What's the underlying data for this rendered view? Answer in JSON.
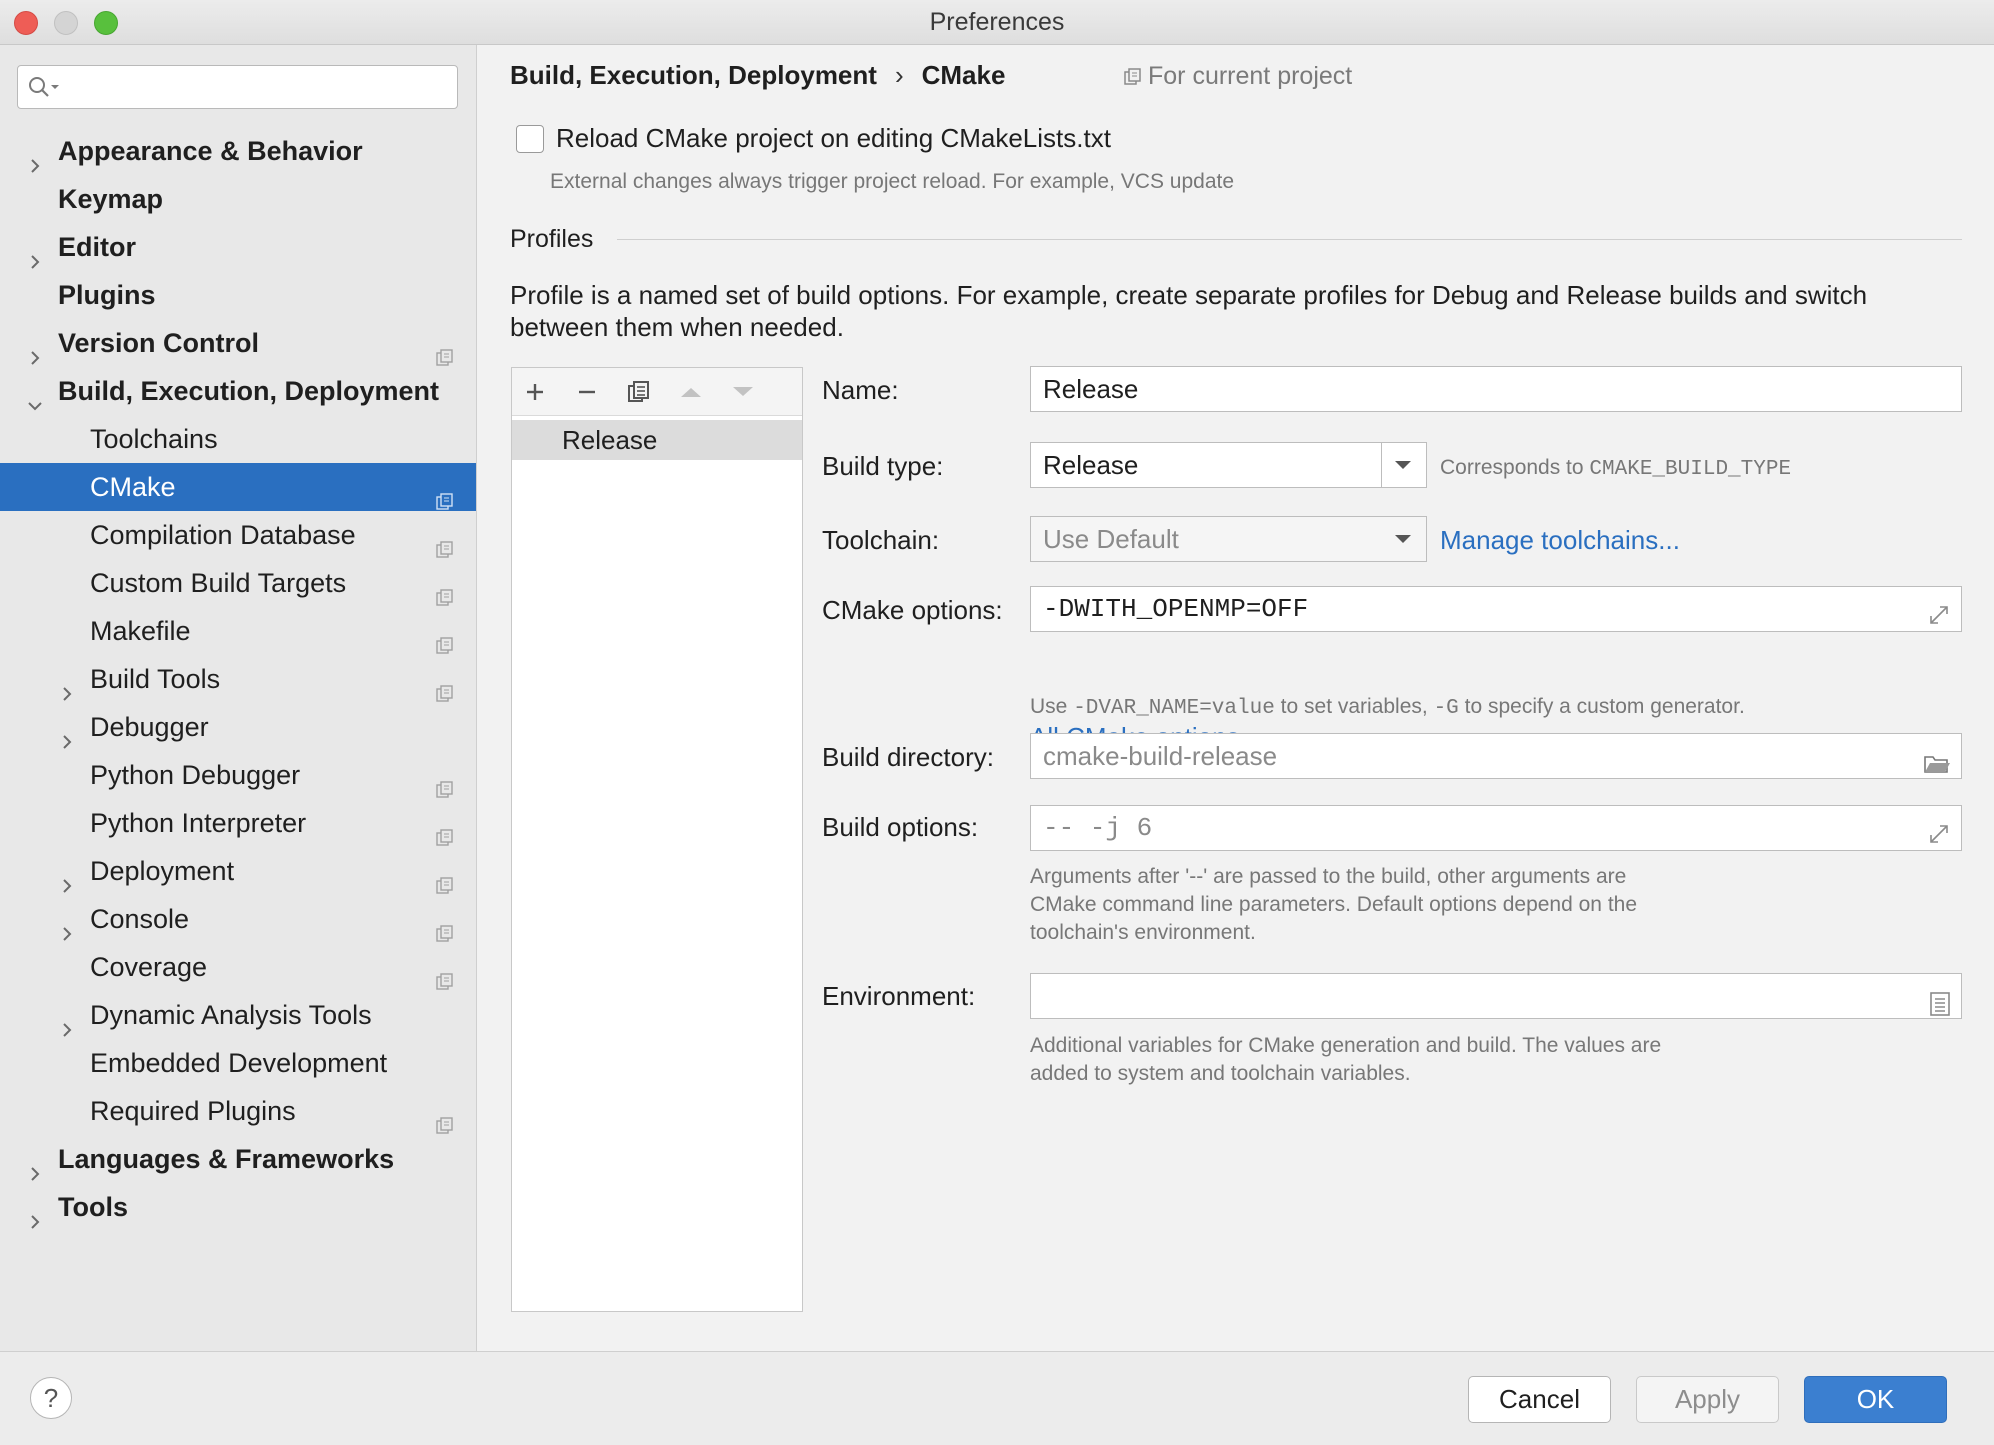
{
  "window": {
    "title": "Preferences"
  },
  "sidebar": {
    "search": {
      "value": "",
      "placeholder": ""
    },
    "items": [
      {
        "label": "Appearance & Behavior",
        "level": 0,
        "bold": true,
        "expander": "collapsed",
        "project_icon": false,
        "selected": false
      },
      {
        "label": "Keymap",
        "level": 0,
        "bold": true,
        "expander": "none",
        "project_icon": false,
        "selected": false
      },
      {
        "label": "Editor",
        "level": 0,
        "bold": true,
        "expander": "collapsed",
        "project_icon": false,
        "selected": false
      },
      {
        "label": "Plugins",
        "level": 0,
        "bold": true,
        "expander": "none",
        "project_icon": false,
        "selected": false
      },
      {
        "label": "Version Control",
        "level": 0,
        "bold": true,
        "expander": "collapsed",
        "project_icon": true,
        "selected": false
      },
      {
        "label": "Build, Execution, Deployment",
        "level": 0,
        "bold": true,
        "expander": "expanded",
        "project_icon": false,
        "selected": false
      },
      {
        "label": "Toolchains",
        "level": 1,
        "bold": false,
        "expander": "none",
        "project_icon": false,
        "selected": false
      },
      {
        "label": "CMake",
        "level": 1,
        "bold": false,
        "expander": "none",
        "project_icon": true,
        "selected": true
      },
      {
        "label": "Compilation Database",
        "level": 1,
        "bold": false,
        "expander": "none",
        "project_icon": true,
        "selected": false
      },
      {
        "label": "Custom Build Targets",
        "level": 1,
        "bold": false,
        "expander": "none",
        "project_icon": true,
        "selected": false
      },
      {
        "label": "Makefile",
        "level": 1,
        "bold": false,
        "expander": "none",
        "project_icon": true,
        "selected": false
      },
      {
        "label": "Build Tools",
        "level": 1,
        "bold": false,
        "expander": "collapsed",
        "project_icon": true,
        "selected": false
      },
      {
        "label": "Debugger",
        "level": 1,
        "bold": false,
        "expander": "collapsed",
        "project_icon": false,
        "selected": false
      },
      {
        "label": "Python Debugger",
        "level": 1,
        "bold": false,
        "expander": "none",
        "project_icon": true,
        "selected": false
      },
      {
        "label": "Python Interpreter",
        "level": 1,
        "bold": false,
        "expander": "none",
        "project_icon": true,
        "selected": false
      },
      {
        "label": "Deployment",
        "level": 1,
        "bold": false,
        "expander": "collapsed",
        "project_icon": true,
        "selected": false
      },
      {
        "label": "Console",
        "level": 1,
        "bold": false,
        "expander": "collapsed",
        "project_icon": true,
        "selected": false
      },
      {
        "label": "Coverage",
        "level": 1,
        "bold": false,
        "expander": "none",
        "project_icon": true,
        "selected": false
      },
      {
        "label": "Dynamic Analysis Tools",
        "level": 1,
        "bold": false,
        "expander": "collapsed",
        "project_icon": false,
        "selected": false
      },
      {
        "label": "Embedded Development",
        "level": 1,
        "bold": false,
        "expander": "none",
        "project_icon": false,
        "selected": false
      },
      {
        "label": "Required Plugins",
        "level": 1,
        "bold": false,
        "expander": "none",
        "project_icon": true,
        "selected": false
      },
      {
        "label": "Languages & Frameworks",
        "level": 0,
        "bold": true,
        "expander": "collapsed",
        "project_icon": false,
        "selected": false
      },
      {
        "label": "Tools",
        "level": 0,
        "bold": true,
        "expander": "collapsed",
        "project_icon": false,
        "selected": false
      }
    ]
  },
  "header": {
    "breadcrumb_parent": "Build, Execution, Deployment",
    "breadcrumb_separator": "›",
    "breadcrumb_current": "CMake",
    "scope": "For current project"
  },
  "reload": {
    "checked": false,
    "label": "Reload CMake project on editing CMakeLists.txt",
    "hint": "External changes always trigger project reload. For example, VCS update"
  },
  "profiles": {
    "section_title": "Profiles",
    "description": "Profile is a named set of build options. For example, create separate profiles for Debug and Release builds and switch between them when needed.",
    "toolbar": [
      "add-icon",
      "remove-icon",
      "copy-icon",
      "move-up-icon",
      "move-down-icon"
    ],
    "list": [
      "Release"
    ],
    "selected_index": 0
  },
  "form": {
    "name": {
      "label": "Name:",
      "value": "Release"
    },
    "build_type": {
      "label": "Build type:",
      "value": "Release",
      "hint_prefix": "Corresponds to ",
      "hint_code": "CMAKE_BUILD_TYPE"
    },
    "toolchain": {
      "label": "Toolchain:",
      "value": "Use Default",
      "link": "Manage toolchains..."
    },
    "cmake_options": {
      "label": "CMake options:",
      "value": "-DWITH_OPENMP=OFF",
      "hint_1": "Use ",
      "hint_code_1": "-DVAR_NAME=value",
      "hint_2": " to set variables, ",
      "hint_code_2": "-G",
      "hint_3": " to specify a custom generator.",
      "link": "All CMake options",
      "link_arrow": "↗"
    },
    "build_directory": {
      "label": "Build directory:",
      "placeholder": "cmake-build-release"
    },
    "build_options": {
      "label": "Build options:",
      "placeholder": "-- -j 6",
      "hint_line1": "Arguments after '--' are passed to the build, other arguments are",
      "hint_line2": "CMake command line parameters. Default options depend on the",
      "hint_line3": "toolchain's environment."
    },
    "environment": {
      "label": "Environment:",
      "value": "",
      "hint_line1": "Additional variables for CMake generation and build. The values are",
      "hint_line2": "added to system and toolchain variables."
    }
  },
  "footer": {
    "help": "?",
    "cancel": "Cancel",
    "apply": "Apply",
    "ok": "OK"
  },
  "colors": {
    "accent": "#2a6fc0",
    "selection": "#2a6fc0",
    "link": "#2a6fc0",
    "ok_button": "#3b7fd0"
  }
}
